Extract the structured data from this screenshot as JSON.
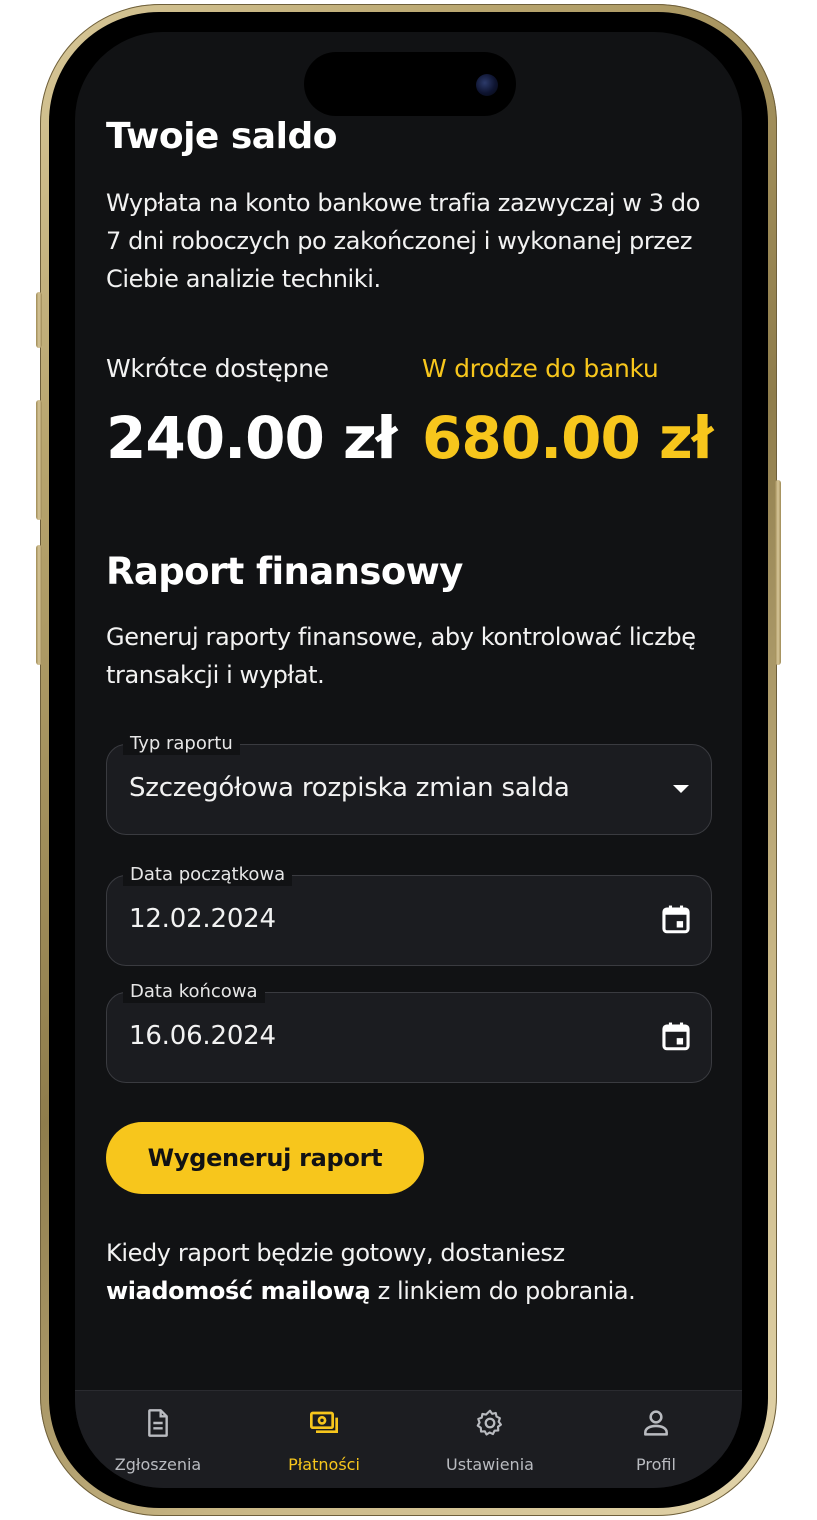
{
  "balance": {
    "title": "Twoje saldo",
    "description": "Wypłata na konto bankowe trafia zazwyczaj w 3 do 7 dni roboczych po zakończonej i wykonanej przez Ciebie analizie techniki.",
    "soon_label": "Wkrótce dostępne",
    "soon_amount": "240.00 zł",
    "bank_label": "W drodze do banku",
    "bank_amount": "680.00 zł"
  },
  "report": {
    "title": "Raport finansowy",
    "description": "Generuj raporty finansowe, aby kontrolować liczbę transakcji i wypłat.",
    "type_label": "Typ raportu",
    "type_value": "Szczegółowa rozpiska zmian salda",
    "start_label": "Data początkowa",
    "start_value": "12.02.2024",
    "end_label": "Data końcowa",
    "end_value": "16.06.2024",
    "button_label": "Wygeneruj raport",
    "note_before": "Kiedy raport będzie gotowy, dostaniesz",
    "note_bold": "wiadomość mailową",
    "note_after": "z linkiem do pobrania."
  },
  "tabs": [
    {
      "label": "Zgłoszenia",
      "icon": "document-icon",
      "active": false
    },
    {
      "label": "Płatności",
      "icon": "cash-icon",
      "active": true
    },
    {
      "label": "Ustawienia",
      "icon": "gear-icon",
      "active": false
    },
    {
      "label": "Profil",
      "icon": "user-icon",
      "active": false
    }
  ],
  "colors": {
    "accent": "#f7c61c",
    "background": "#111214",
    "field": "#1b1c20",
    "tabbar": "#1c1d21"
  }
}
